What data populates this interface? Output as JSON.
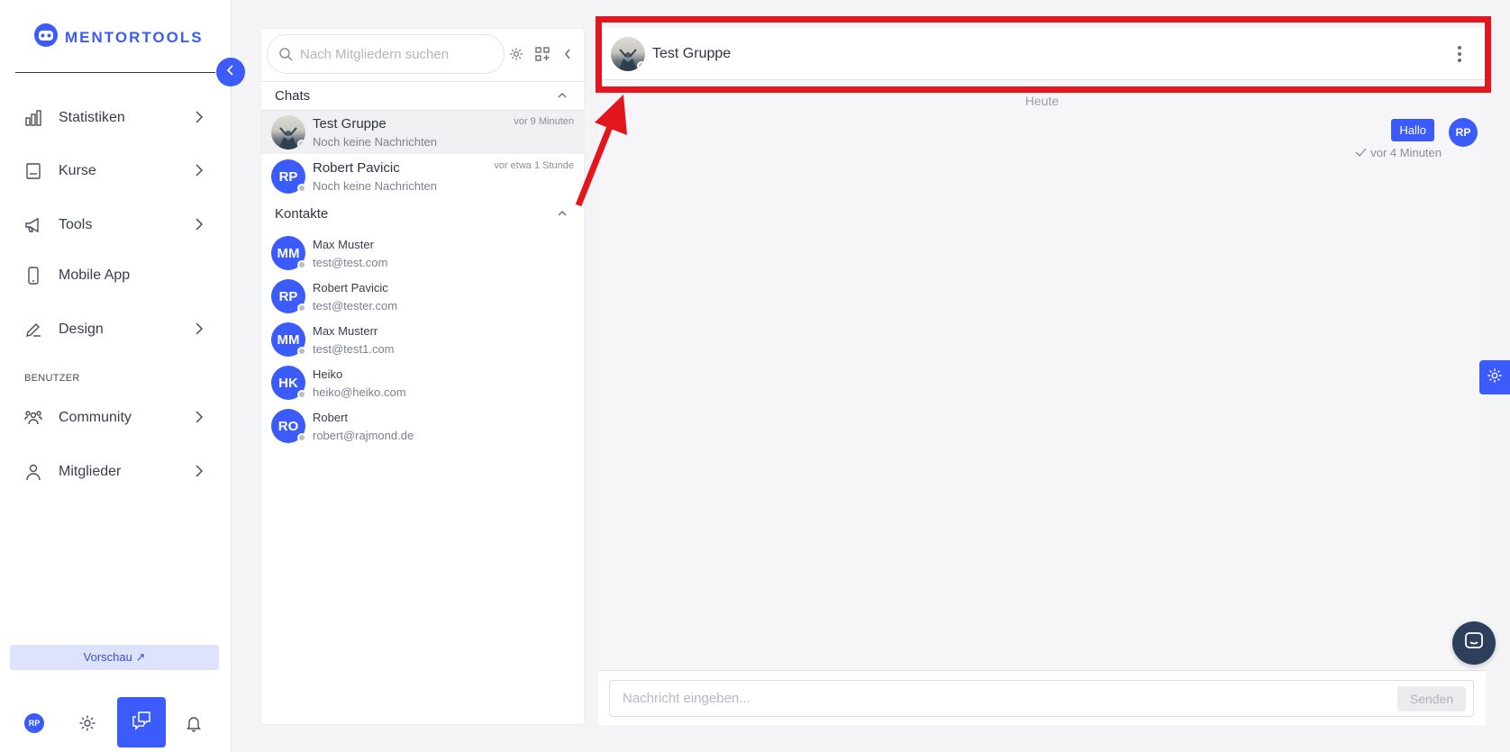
{
  "brand": {
    "name": "MENTORTOOLS",
    "accent": "#3b5bfa"
  },
  "sidebar": {
    "items": [
      {
        "label": "Statistiken",
        "icon": "bar-chart-icon"
      },
      {
        "label": "Kurse",
        "icon": "book-icon"
      },
      {
        "label": "Tools",
        "icon": "megaphone-icon"
      },
      {
        "label": "Mobile App",
        "icon": "phone-icon"
      },
      {
        "label": "Design",
        "icon": "pencil-icon"
      }
    ],
    "section_label": "BENUTZER",
    "user_items": [
      {
        "label": "Community",
        "icon": "people-icon"
      },
      {
        "label": "Mitglieder",
        "icon": "person-icon"
      }
    ],
    "preview_label": "Vorschau ↗",
    "bottom": {
      "avatar_initials": "RP"
    }
  },
  "chat_list": {
    "search_placeholder": "Nach Mitgliedern suchen",
    "chats_heading": "Chats",
    "chats": [
      {
        "name": "Test Gruppe",
        "preview": "Noch keine Nachrichten",
        "time": "vor 9 Minuten",
        "avatar": "photo"
      },
      {
        "name": "Robert Pavicic",
        "preview": "Noch keine Nachrichten",
        "time": "vor etwa 1 Stunde",
        "initials": "RP"
      }
    ],
    "contacts_heading": "Kontakte",
    "contacts": [
      {
        "initials": "MM",
        "name": "Max Muster",
        "email": "test@test.com"
      },
      {
        "initials": "RP",
        "name": "Robert Pavicic",
        "email": "test@tester.com"
      },
      {
        "initials": "MM",
        "name": "Max Musterr",
        "email": "test@test1.com"
      },
      {
        "initials": "HK",
        "name": "Heiko",
        "email": "heiko@heiko.com"
      },
      {
        "initials": "RO",
        "name": "Robert",
        "email": "robert@rajmond.de"
      }
    ]
  },
  "conversation": {
    "title": "Test Gruppe",
    "day_label": "Heute",
    "messages": [
      {
        "text": "Hallo",
        "sender_initials": "RP",
        "time": "vor 4 Minuten"
      }
    ],
    "input_placeholder": "Nachricht eingeben...",
    "send_label": "Senden"
  },
  "annotation": {
    "color": "#e3161d"
  }
}
